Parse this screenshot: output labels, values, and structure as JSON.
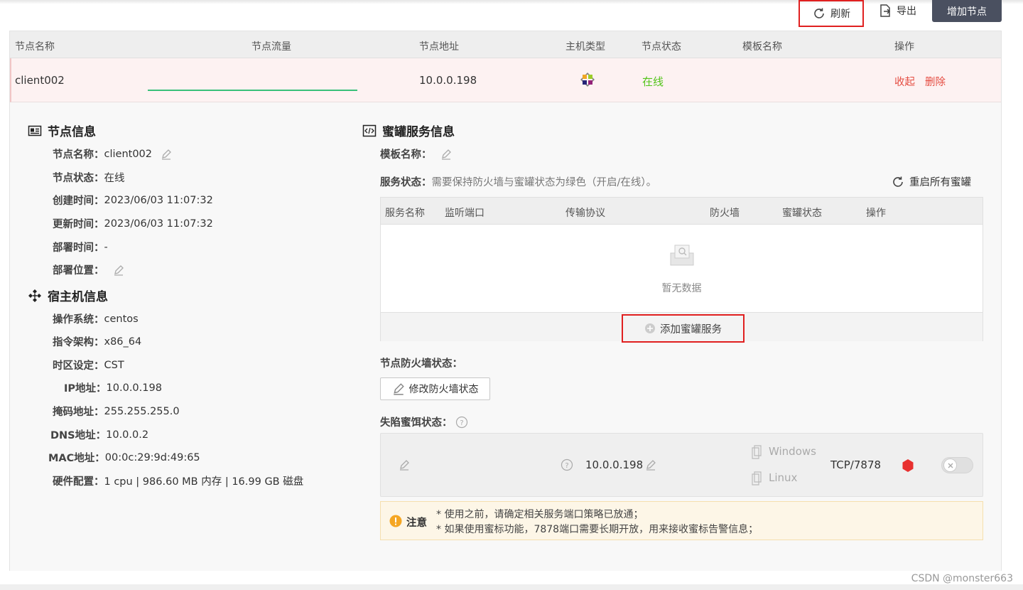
{
  "toolbar": {
    "refresh": "刷新",
    "export": "导出",
    "add_node": "增加节点"
  },
  "table": {
    "headers": [
      "节点名称",
      "节点流量",
      "节点地址",
      "主机类型",
      "节点状态",
      "模板名称",
      "操作"
    ],
    "row": {
      "name": "client002",
      "address": "10.0.0.198",
      "status": "在线",
      "template": "",
      "actions": [
        "收起",
        "删除"
      ]
    }
  },
  "node_info": {
    "title": "节点信息",
    "items": [
      {
        "key": "节点名称：",
        "value": "client002"
      },
      {
        "key": "节点状态：",
        "value": "在线"
      },
      {
        "key": "创建时间：",
        "value": "2023/06/03 11:07:32"
      },
      {
        "key": "更新时间：",
        "value": "2023/06/03 11:07:32"
      },
      {
        "key": "部署时间：",
        "value": "-"
      },
      {
        "key": "部署位置：",
        "value": ""
      }
    ]
  },
  "host_info": {
    "title": "宿主机信息",
    "items": [
      {
        "key": "操作系统：",
        "value": "centos"
      },
      {
        "key": "指令架构：",
        "value": "x86_64"
      },
      {
        "key": "时区设定：",
        "value": "CST"
      },
      {
        "key": "IP地址：",
        "value": "10.0.0.198"
      },
      {
        "key": "掩码地址：",
        "value": "255.255.255.0"
      },
      {
        "key": "DNS地址：",
        "value": "10.0.0.2"
      },
      {
        "key": "MAC地址：",
        "value": "00:0c:29:9d:49:65"
      },
      {
        "key": "硬件配置：",
        "value": "1 cpu | 986.60 MB 内存 | 16.99 GB 磁盘"
      }
    ]
  },
  "honeypot": {
    "title": "蜜罐服务信息",
    "template_label": "模板名称：",
    "status_label": "服务状态：",
    "status_hint": "需要保持防火墙与蜜罐状态为绿色（开启/在线）。",
    "restart_all": "重启所有蜜罐",
    "svc_headers": [
      "服务名称",
      "监听端口",
      "传输协议",
      "防火墙",
      "蜜罐状态",
      "操作"
    ],
    "empty_text": "暂无数据",
    "add_service": "添加蜜罐服务",
    "firewall_label": "节点防火墙状态：",
    "firewall_btn": "修改防火墙状态",
    "trap_label": "失陷蜜饵状态：",
    "trap": {
      "ip": "10.0.0.198",
      "os1": "Windows",
      "os2": "Linux",
      "port": "TCP/7878"
    },
    "notice": {
      "label": "注意",
      "line1": "* 使用之前，请确定相关服务端口策略已放通；",
      "line2": "* 如果使用蜜标功能，7878端口需要长期开放，用来接收蜜标告警信息；"
    }
  },
  "watermark": "CSDN @monster663",
  "colors": {
    "online": "#52c41a",
    "danger": "#e54d42",
    "dark_button": "#4a5060",
    "flow": "#39c07a"
  }
}
